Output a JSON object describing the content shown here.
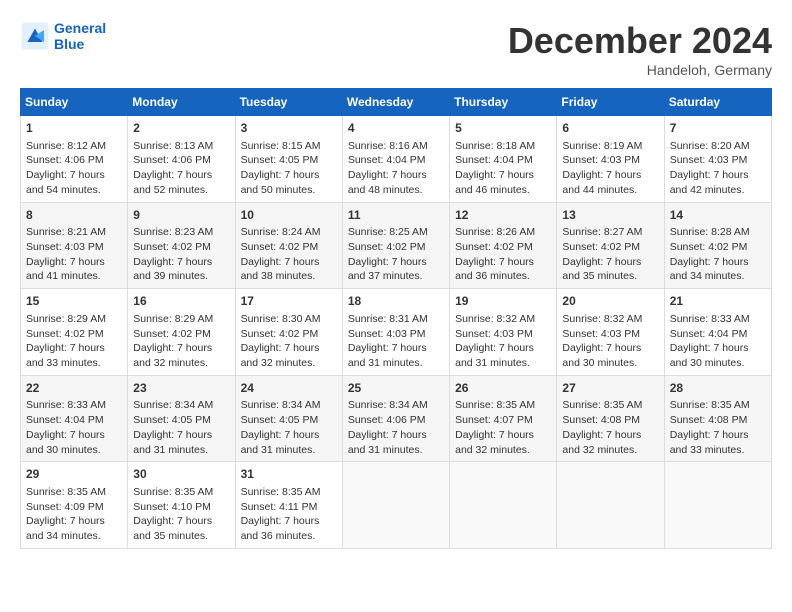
{
  "header": {
    "logo_line1": "General",
    "logo_line2": "Blue",
    "month": "December 2024",
    "location": "Handeloh, Germany"
  },
  "days_of_week": [
    "Sunday",
    "Monday",
    "Tuesday",
    "Wednesday",
    "Thursday",
    "Friday",
    "Saturday"
  ],
  "weeks": [
    [
      {
        "day": "1",
        "sunrise": "8:12 AM",
        "sunset": "4:06 PM",
        "daylight": "7 hours and 54 minutes."
      },
      {
        "day": "2",
        "sunrise": "8:13 AM",
        "sunset": "4:06 PM",
        "daylight": "7 hours and 52 minutes."
      },
      {
        "day": "3",
        "sunrise": "8:15 AM",
        "sunset": "4:05 PM",
        "daylight": "7 hours and 50 minutes."
      },
      {
        "day": "4",
        "sunrise": "8:16 AM",
        "sunset": "4:04 PM",
        "daylight": "7 hours and 48 minutes."
      },
      {
        "day": "5",
        "sunrise": "8:18 AM",
        "sunset": "4:04 PM",
        "daylight": "7 hours and 46 minutes."
      },
      {
        "day": "6",
        "sunrise": "8:19 AM",
        "sunset": "4:03 PM",
        "daylight": "7 hours and 44 minutes."
      },
      {
        "day": "7",
        "sunrise": "8:20 AM",
        "sunset": "4:03 PM",
        "daylight": "7 hours and 42 minutes."
      }
    ],
    [
      {
        "day": "8",
        "sunrise": "8:21 AM",
        "sunset": "4:03 PM",
        "daylight": "7 hours and 41 minutes."
      },
      {
        "day": "9",
        "sunrise": "8:23 AM",
        "sunset": "4:02 PM",
        "daylight": "7 hours and 39 minutes."
      },
      {
        "day": "10",
        "sunrise": "8:24 AM",
        "sunset": "4:02 PM",
        "daylight": "7 hours and 38 minutes."
      },
      {
        "day": "11",
        "sunrise": "8:25 AM",
        "sunset": "4:02 PM",
        "daylight": "7 hours and 37 minutes."
      },
      {
        "day": "12",
        "sunrise": "8:26 AM",
        "sunset": "4:02 PM",
        "daylight": "7 hours and 36 minutes."
      },
      {
        "day": "13",
        "sunrise": "8:27 AM",
        "sunset": "4:02 PM",
        "daylight": "7 hours and 35 minutes."
      },
      {
        "day": "14",
        "sunrise": "8:28 AM",
        "sunset": "4:02 PM",
        "daylight": "7 hours and 34 minutes."
      }
    ],
    [
      {
        "day": "15",
        "sunrise": "8:29 AM",
        "sunset": "4:02 PM",
        "daylight": "7 hours and 33 minutes."
      },
      {
        "day": "16",
        "sunrise": "8:29 AM",
        "sunset": "4:02 PM",
        "daylight": "7 hours and 32 minutes."
      },
      {
        "day": "17",
        "sunrise": "8:30 AM",
        "sunset": "4:02 PM",
        "daylight": "7 hours and 32 minutes."
      },
      {
        "day": "18",
        "sunrise": "8:31 AM",
        "sunset": "4:03 PM",
        "daylight": "7 hours and 31 minutes."
      },
      {
        "day": "19",
        "sunrise": "8:32 AM",
        "sunset": "4:03 PM",
        "daylight": "7 hours and 31 minutes."
      },
      {
        "day": "20",
        "sunrise": "8:32 AM",
        "sunset": "4:03 PM",
        "daylight": "7 hours and 30 minutes."
      },
      {
        "day": "21",
        "sunrise": "8:33 AM",
        "sunset": "4:04 PM",
        "daylight": "7 hours and 30 minutes."
      }
    ],
    [
      {
        "day": "22",
        "sunrise": "8:33 AM",
        "sunset": "4:04 PM",
        "daylight": "7 hours and 30 minutes."
      },
      {
        "day": "23",
        "sunrise": "8:34 AM",
        "sunset": "4:05 PM",
        "daylight": "7 hours and 31 minutes."
      },
      {
        "day": "24",
        "sunrise": "8:34 AM",
        "sunset": "4:05 PM",
        "daylight": "7 hours and 31 minutes."
      },
      {
        "day": "25",
        "sunrise": "8:34 AM",
        "sunset": "4:06 PM",
        "daylight": "7 hours and 31 minutes."
      },
      {
        "day": "26",
        "sunrise": "8:35 AM",
        "sunset": "4:07 PM",
        "daylight": "7 hours and 32 minutes."
      },
      {
        "day": "27",
        "sunrise": "8:35 AM",
        "sunset": "4:08 PM",
        "daylight": "7 hours and 32 minutes."
      },
      {
        "day": "28",
        "sunrise": "8:35 AM",
        "sunset": "4:08 PM",
        "daylight": "7 hours and 33 minutes."
      }
    ],
    [
      {
        "day": "29",
        "sunrise": "8:35 AM",
        "sunset": "4:09 PM",
        "daylight": "7 hours and 34 minutes."
      },
      {
        "day": "30",
        "sunrise": "8:35 AM",
        "sunset": "4:10 PM",
        "daylight": "7 hours and 35 minutes."
      },
      {
        "day": "31",
        "sunrise": "8:35 AM",
        "sunset": "4:11 PM",
        "daylight": "7 hours and 36 minutes."
      },
      null,
      null,
      null,
      null
    ]
  ]
}
